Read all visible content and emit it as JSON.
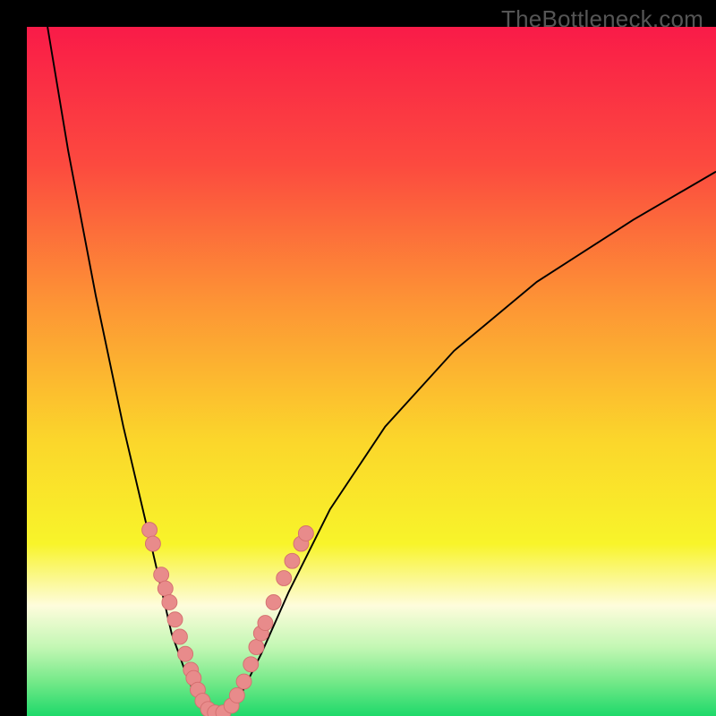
{
  "watermark": "TheBottleneck.com",
  "colors": {
    "black": "#000000",
    "curve": "#000000",
    "dot_fill": "#e88b8b",
    "dot_stroke": "#d46f6f",
    "gradient_stops": [
      {
        "offset": 0.0,
        "color": "#f91b48"
      },
      {
        "offset": 0.2,
        "color": "#fc4a3f"
      },
      {
        "offset": 0.4,
        "color": "#fd9435"
      },
      {
        "offset": 0.6,
        "color": "#fbd62b"
      },
      {
        "offset": 0.75,
        "color": "#f8f42a"
      },
      {
        "offset": 0.8,
        "color": "#fbf88e"
      },
      {
        "offset": 0.84,
        "color": "#fefcdc"
      },
      {
        "offset": 0.9,
        "color": "#c3f7b4"
      },
      {
        "offset": 0.95,
        "color": "#75e989"
      },
      {
        "offset": 1.0,
        "color": "#1ed96a"
      }
    ]
  },
  "chart_data": {
    "type": "line",
    "title": "",
    "xlabel": "",
    "ylabel": "",
    "xlim": [
      0,
      1
    ],
    "ylim": [
      0,
      1
    ],
    "series": [
      {
        "name": "left-curve",
        "x": [
          0.03,
          0.06,
          0.1,
          0.14,
          0.18,
          0.21,
          0.235,
          0.255,
          0.27
        ],
        "y": [
          1.0,
          0.82,
          0.61,
          0.42,
          0.25,
          0.12,
          0.05,
          0.015,
          0.0
        ]
      },
      {
        "name": "right-curve",
        "x": [
          0.29,
          0.31,
          0.34,
          0.38,
          0.44,
          0.52,
          0.62,
          0.74,
          0.88,
          1.0
        ],
        "y": [
          0.0,
          0.03,
          0.09,
          0.18,
          0.3,
          0.42,
          0.53,
          0.63,
          0.72,
          0.79
        ]
      }
    ],
    "annotations": {
      "highlight_dots": [
        {
          "x": 0.178,
          "y": 0.27
        },
        {
          "x": 0.183,
          "y": 0.25
        },
        {
          "x": 0.195,
          "y": 0.205
        },
        {
          "x": 0.201,
          "y": 0.185
        },
        {
          "x": 0.207,
          "y": 0.165
        },
        {
          "x": 0.215,
          "y": 0.14
        },
        {
          "x": 0.222,
          "y": 0.115
        },
        {
          "x": 0.23,
          "y": 0.09
        },
        {
          "x": 0.238,
          "y": 0.067
        },
        {
          "x": 0.242,
          "y": 0.055
        },
        {
          "x": 0.248,
          "y": 0.038
        },
        {
          "x": 0.255,
          "y": 0.022
        },
        {
          "x": 0.263,
          "y": 0.01
        },
        {
          "x": 0.273,
          "y": 0.005
        },
        {
          "x": 0.285,
          "y": 0.005
        },
        {
          "x": 0.297,
          "y": 0.015
        },
        {
          "x": 0.305,
          "y": 0.03
        },
        {
          "x": 0.315,
          "y": 0.05
        },
        {
          "x": 0.325,
          "y": 0.075
        },
        {
          "x": 0.333,
          "y": 0.1
        },
        {
          "x": 0.34,
          "y": 0.12
        },
        {
          "x": 0.346,
          "y": 0.135
        },
        {
          "x": 0.358,
          "y": 0.165
        },
        {
          "x": 0.373,
          "y": 0.2
        },
        {
          "x": 0.385,
          "y": 0.225
        },
        {
          "x": 0.398,
          "y": 0.25
        },
        {
          "x": 0.405,
          "y": 0.265
        }
      ]
    }
  }
}
